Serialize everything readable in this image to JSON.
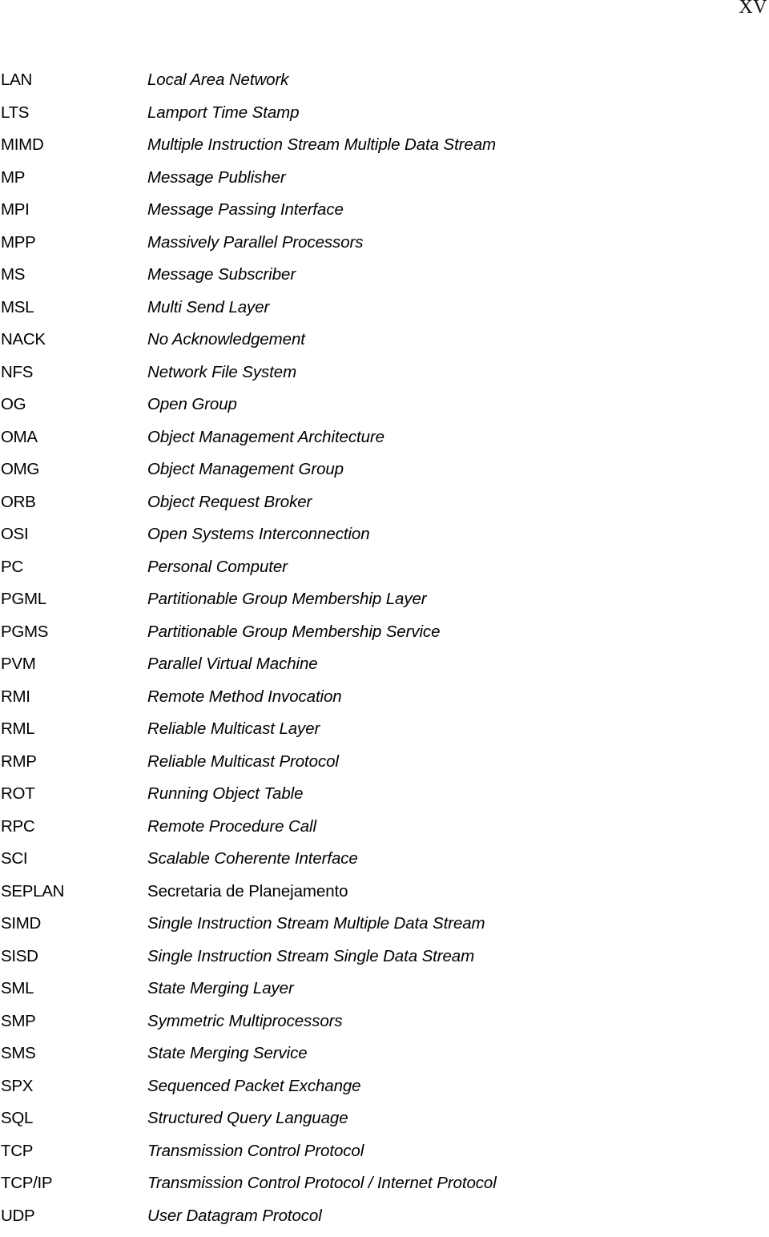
{
  "page": {
    "number": "XV"
  },
  "abbreviations": [
    {
      "term": "LAN",
      "definition": "Local Area Network",
      "italic": true
    },
    {
      "term": "LTS",
      "definition": "Lamport Time Stamp",
      "italic": true
    },
    {
      "term": "MIMD",
      "definition": "Multiple Instruction Stream Multiple Data Stream",
      "italic": true
    },
    {
      "term": "MP",
      "definition": "Message Publisher",
      "italic": true
    },
    {
      "term": "MPI",
      "definition": "Message Passing Interface",
      "italic": true
    },
    {
      "term": "MPP",
      "definition": "Massively Parallel Processors",
      "italic": true
    },
    {
      "term": "MS",
      "definition": "Message Subscriber",
      "italic": true
    },
    {
      "term": "MSL",
      "definition": "Multi Send Layer",
      "italic": true
    },
    {
      "term": "NACK",
      "definition": "No Acknowledgement",
      "italic": true
    },
    {
      "term": "NFS",
      "definition": "Network File System",
      "italic": true
    },
    {
      "term": "OG",
      "definition": "Open Group",
      "italic": true
    },
    {
      "term": "OMA",
      "definition": "Object Management Architecture",
      "italic": true
    },
    {
      "term": "OMG",
      "definition": "Object Management Group",
      "italic": true
    },
    {
      "term": "ORB",
      "definition": "Object Request Broker",
      "italic": true
    },
    {
      "term": "OSI",
      "definition": "Open Systems Interconnection",
      "italic": true
    },
    {
      "term": "PC",
      "definition": "Personal Computer",
      "italic": true
    },
    {
      "term": "PGML",
      "definition": "Partitionable Group Membership Layer",
      "italic": true
    },
    {
      "term": "PGMS",
      "definition": "Partitionable Group Membership Service",
      "italic": true
    },
    {
      "term": "PVM",
      "definition": "Parallel Virtual Machine",
      "italic": true
    },
    {
      "term": "RMI",
      "definition": "Remote Method Invocation",
      "italic": true
    },
    {
      "term": "RML",
      "definition": "Reliable Multicast Layer",
      "italic": true
    },
    {
      "term": "RMP",
      "definition": "Reliable Multicast Protocol",
      "italic": true
    },
    {
      "term": "ROT",
      "definition": "Running Object Table",
      "italic": true
    },
    {
      "term": "RPC",
      "definition": "Remote Procedure Call",
      "italic": true
    },
    {
      "term": "SCI",
      "definition": "Scalable Coherente Interface",
      "italic": true
    },
    {
      "term": "SEPLAN",
      "definition": "Secretaria de Planejamento",
      "italic": false
    },
    {
      "term": "SIMD",
      "definition": "Single Instruction Stream Multiple Data Stream",
      "italic": true
    },
    {
      "term": "SISD",
      "definition": "Single Instruction Stream Single Data Stream",
      "italic": true
    },
    {
      "term": "SML",
      "definition": "State Merging Layer",
      "italic": true
    },
    {
      "term": "SMP",
      "definition": "Symmetric Multiprocessors",
      "italic": true
    },
    {
      "term": "SMS",
      "definition": "State Merging Service",
      "italic": true
    },
    {
      "term": "SPX",
      "definition": "Sequenced Packet Exchange",
      "italic": true
    },
    {
      "term": "SQL",
      "definition": "Structured Query Language",
      "italic": true
    },
    {
      "term": "TCP",
      "definition": "Transmission Control Protocol",
      "italic": true
    },
    {
      "term": "TCP/IP",
      "definition": "Transmission Control Protocol / Internet Protocol",
      "italic": true
    },
    {
      "term": "UDP",
      "definition": "User Datagram Protocol",
      "italic": true
    }
  ]
}
